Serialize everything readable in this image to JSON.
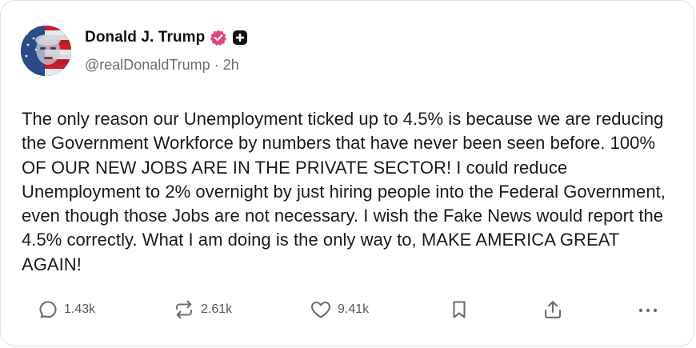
{
  "author": {
    "name": "Donald J. Trump",
    "handle": "@realDonaldTrump",
    "separator": "·",
    "time": "2h"
  },
  "post": {
    "text": "The only reason our Unemployment ticked up to 4.5% is because we are reducing the Government Workforce by numbers that have never been seen before. 100% OF OUR NEW JOBS ARE IN THE PRIVATE SECTOR! I could reduce Unemployment to 2% overnight by just hiring people into the Federal Government, even though those Jobs are not necessary. I wish the Fake News would report the 4.5% correctly. What I am doing is the only way to, MAKE AMERICA GREAT AGAIN!"
  },
  "actions": {
    "replies": "1.43k",
    "reposts": "2.61k",
    "likes": "9.41k"
  },
  "icons": {
    "reply": "reply-icon",
    "repost": "repost-icon",
    "like": "heart-icon",
    "bookmark": "bookmark-icon",
    "share": "share-icon",
    "more": "more-icon",
    "verified": "verified-badge-icon",
    "plus": "plus-badge-icon"
  },
  "colors": {
    "verified": "#e0457b",
    "text": "#1a1a1a",
    "muted": "#6b6b73",
    "border": "#e3e3e6"
  }
}
